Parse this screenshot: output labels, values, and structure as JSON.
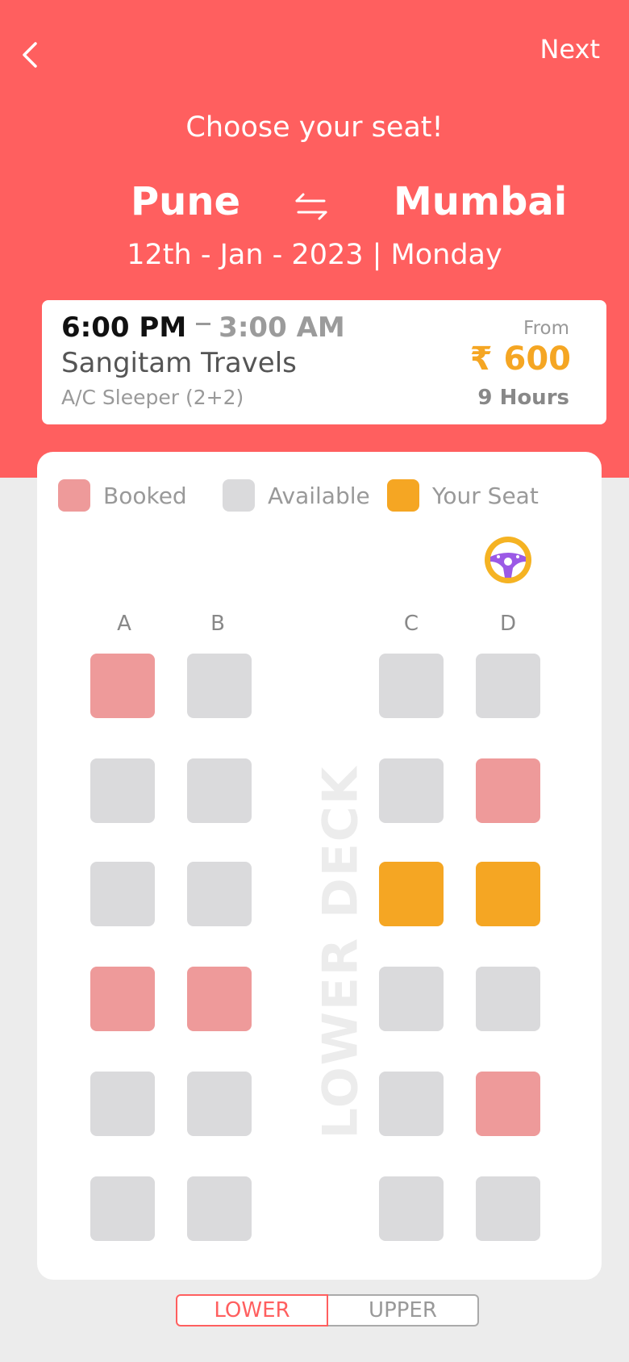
{
  "colors": {
    "header_bg": "#ff5f5f",
    "booked": "#ee9a9a",
    "available": "#dadadc",
    "your_seat": "#f5a623",
    "price": "#f5a623"
  },
  "header": {
    "back_icon": "chevron-left-icon",
    "next_label": "Next",
    "title": "Choose your seat!",
    "from_city": "Pune",
    "swap_icon": "swap-arrows-icon",
    "to_city": "Mumbai",
    "date": "12th - Jan - 2023 | Monday"
  },
  "trip": {
    "departure": "6:00 PM",
    "arrival": "3:00 AM",
    "operator": "Sangitam Travels",
    "bus_type": "A/C Sleeper (2+2)",
    "from_label": "From",
    "price": "₹ 600",
    "duration": "9 Hours"
  },
  "legend": {
    "booked": "Booked",
    "available": "Available",
    "your_seat": "Your Seat"
  },
  "layout": {
    "steering_icon": "steering-wheel-icon",
    "columns": [
      "A",
      "B",
      "C",
      "D"
    ],
    "deck_name": "LOWER DECK",
    "rows": [
      [
        "booked",
        "available",
        "available",
        "available"
      ],
      [
        "available",
        "available",
        "available",
        "booked"
      ],
      [
        "available",
        "available",
        "selected",
        "selected"
      ],
      [
        "booked",
        "booked",
        "available",
        "available"
      ],
      [
        "available",
        "available",
        "available",
        "booked"
      ],
      [
        "available",
        "available",
        "available",
        "available"
      ]
    ]
  },
  "deck_toggle": {
    "lower": "LOWER",
    "upper": "UPPER",
    "active": "lower"
  }
}
